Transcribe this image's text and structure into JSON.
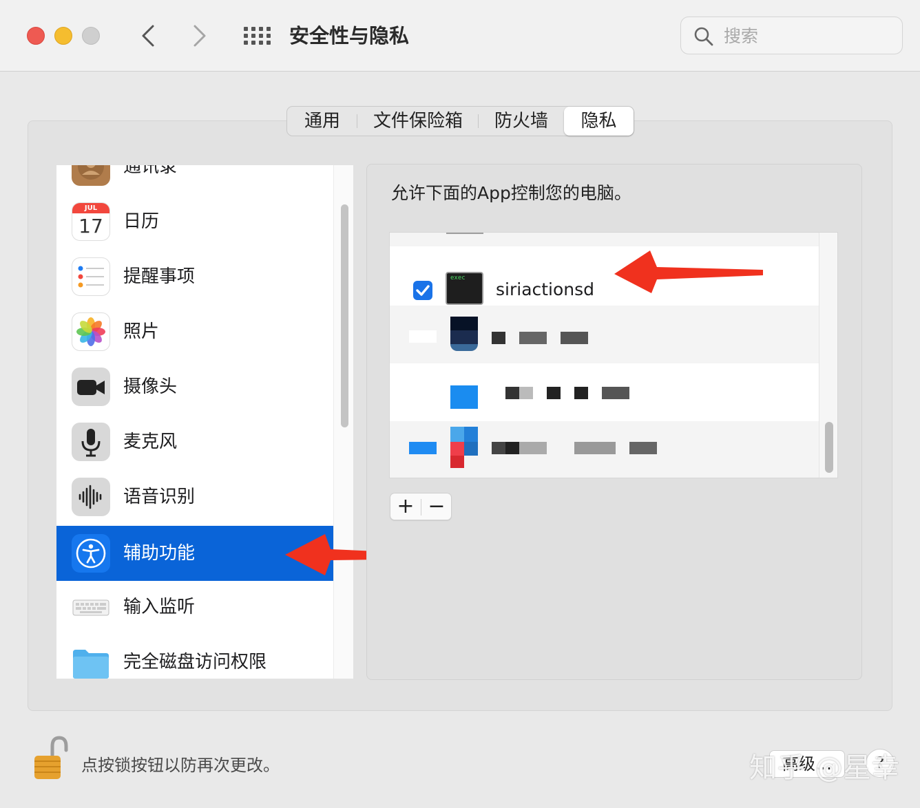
{
  "window": {
    "title": "安全性与隐私"
  },
  "search": {
    "placeholder": "搜索"
  },
  "tabs": [
    {
      "label": "通用",
      "selected": false
    },
    {
      "label": "文件保险箱",
      "selected": false
    },
    {
      "label": "防火墙",
      "selected": false
    },
    {
      "label": "隐私",
      "selected": true
    }
  ],
  "sidebar": {
    "items": [
      {
        "label": "通讯录",
        "icon": "contacts-icon"
      },
      {
        "label": "日历",
        "icon": "calendar-icon",
        "icon_month": "JUL",
        "icon_day": "17"
      },
      {
        "label": "提醒事项",
        "icon": "reminders-icon"
      },
      {
        "label": "照片",
        "icon": "photos-icon"
      },
      {
        "label": "摄像头",
        "icon": "camera-icon"
      },
      {
        "label": "麦克风",
        "icon": "microphone-icon"
      },
      {
        "label": "语音识别",
        "icon": "speech-recognition-icon"
      },
      {
        "label": "辅助功能",
        "icon": "accessibility-icon",
        "selected": true
      },
      {
        "label": "输入监听",
        "icon": "keyboard-icon"
      },
      {
        "label": "完全磁盘访问权限",
        "icon": "folder-icon"
      }
    ]
  },
  "main": {
    "description": "允许下面的App控制您的电脑。",
    "apps": [
      {
        "name": "siriactionsd",
        "checked": true,
        "icon": "exec-terminal-icon",
        "icon_text": "exec"
      }
    ],
    "add_label": "+",
    "remove_label": "−"
  },
  "footer": {
    "lock_text": "点按锁按钮以防再次更改。",
    "advanced_label": "高级…",
    "help_label": "?"
  },
  "watermark": "知乎 @星幸",
  "colors": {
    "selection_blue": "#0a64d8",
    "checkbox_blue": "#1a73e8",
    "annotation_red": "#f0311e"
  }
}
